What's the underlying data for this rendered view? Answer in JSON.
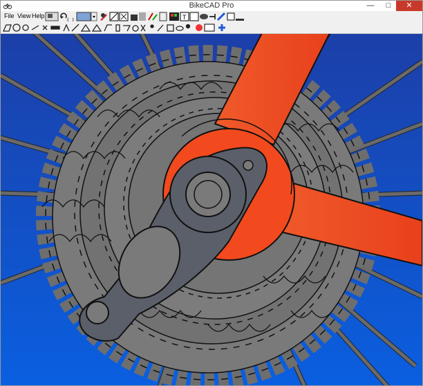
{
  "window": {
    "title": "BikeCAD Pro",
    "controls": {
      "minimize": "—",
      "maximize": "□",
      "close": "✕"
    }
  },
  "menu": {
    "file": "File",
    "view": "View",
    "help": "Help"
  },
  "toolbar_icons": {
    "row1": [
      "save-icon",
      "undo-icon",
      "redo-icon",
      "image-icon",
      "dropdown-icon",
      "tools-icon",
      "frame-icon",
      "dimension-icon",
      "lock-icon",
      "gradient-icon",
      "color-icon",
      "measure-icon",
      "photo-icon",
      "text-icon",
      "settings-icon",
      "eye-icon",
      "tape-icon",
      "pencil-icon",
      "layers-icon",
      "paint-icon",
      "grid-icon",
      "chart-icon"
    ],
    "row2": [
      "bike-icon",
      "wheel-icon",
      "stem-icon",
      "crank-icon",
      "chain-icon",
      "derailleur-icon",
      "seatpost-icon",
      "fork-icon",
      "frame-tube-icon",
      "rack-icon",
      "fender-icon",
      "light-icon",
      "bottle-icon",
      "lock-icon",
      "pump-icon",
      "person-icon",
      "rect-icon",
      "oval-icon",
      "user-icon",
      "color-wheel-icon",
      "monitor-icon",
      "plus-icon"
    ]
  },
  "colors": {
    "background_top": "#1c3fa8",
    "background_bottom": "#0a5fe0",
    "frame": "#f24a1e",
    "cassette": "#7a7a7a",
    "dropout": "#5a5f69",
    "spoke": "#4a4a4a"
  }
}
